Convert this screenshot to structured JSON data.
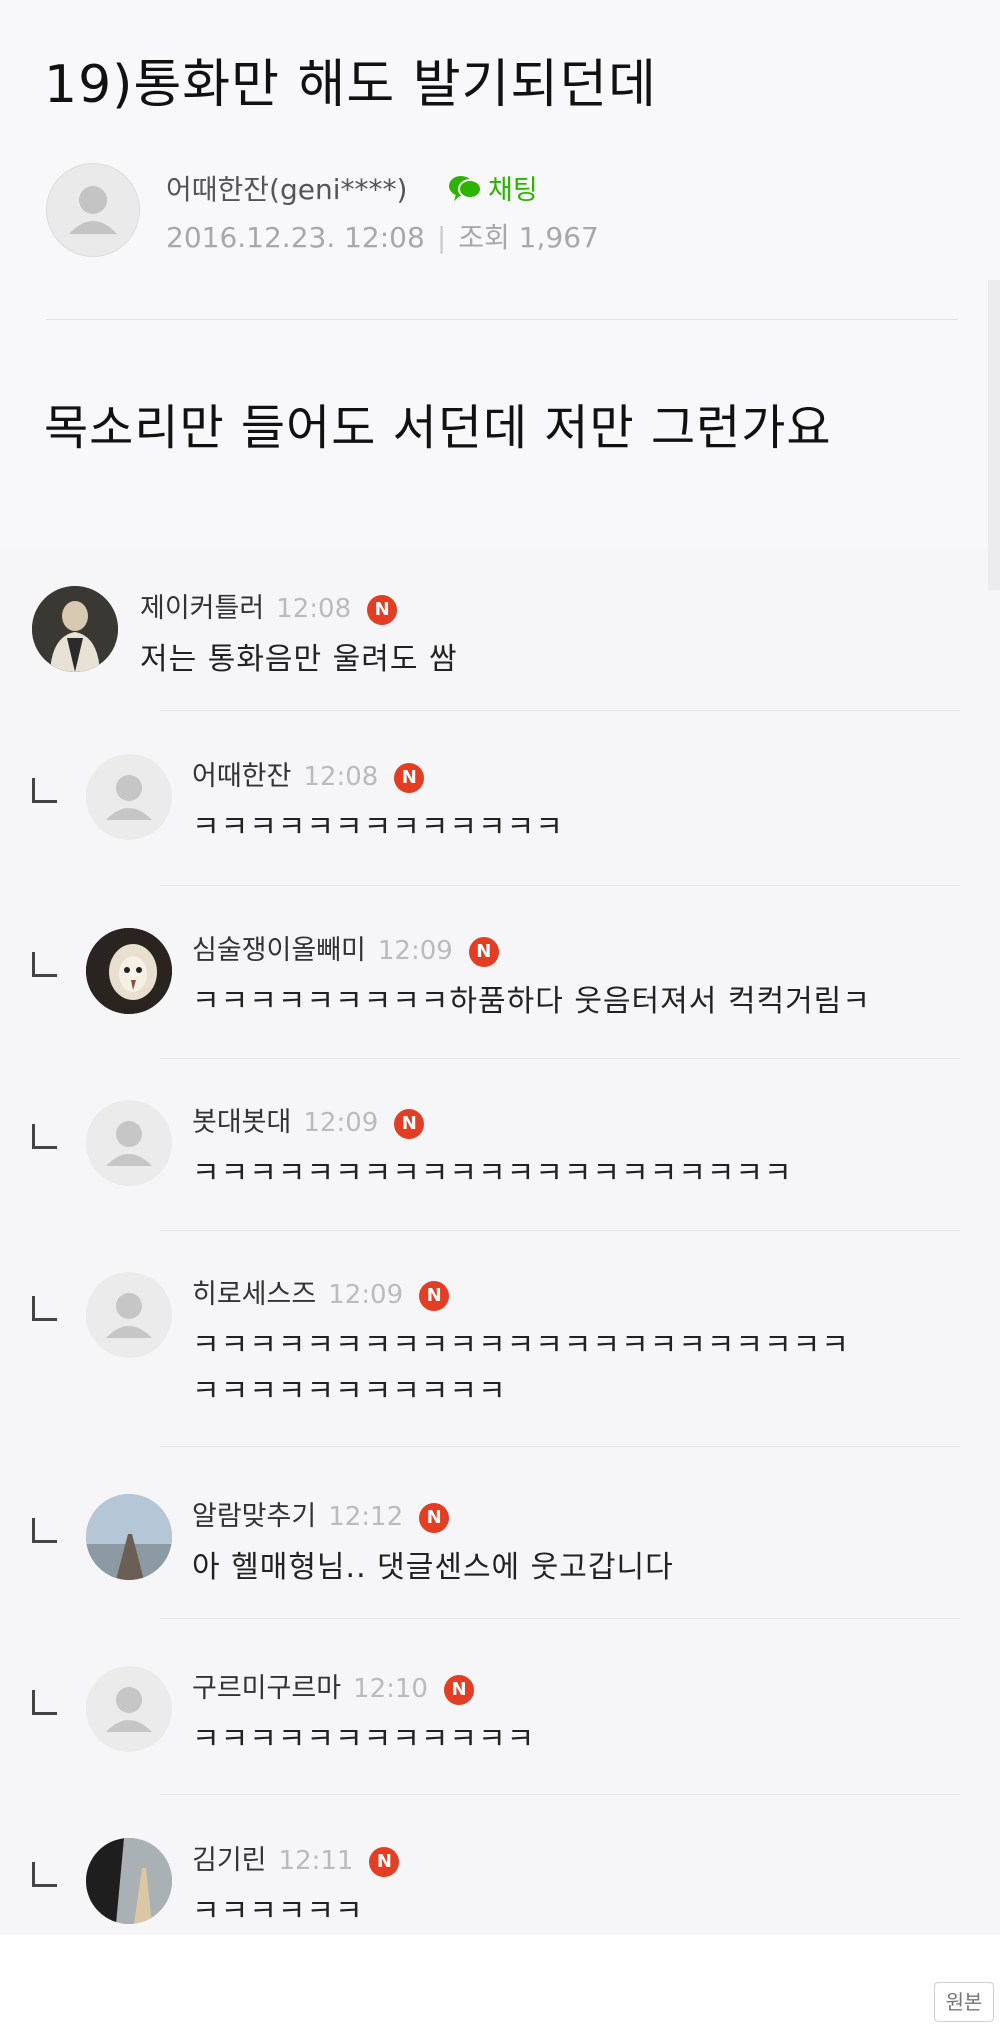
{
  "post": {
    "title": "19)통화만 해도 발기되던데",
    "author": "어때한잔(geni****)",
    "chat_label": "채팅",
    "date": "2016.12.23. 12:08",
    "views": "조회 1,967",
    "body": "목소리만 들어도 서던데 저만 그런가요"
  },
  "comments": [
    {
      "name": "제이커틀러",
      "time": "12:08",
      "badge": "N",
      "lines": [
        "저는 통화음만 울려도 쌈"
      ],
      "reply": false
    },
    {
      "name": "어때한잔",
      "time": "12:08",
      "badge": "N",
      "lines": [
        "ㅋㅋㅋㅋㅋㅋㅋㅋㅋㅋㅋㅋㅋ"
      ],
      "reply": true
    },
    {
      "name": "심술쟁이올빼미",
      "time": "12:09",
      "badge": "N",
      "lines": [
        "ㅋㅋㅋㅋㅋㅋㅋㅋㅋ하품하다 웃음터져서 컥컥거림ㅋ"
      ],
      "reply": true
    },
    {
      "name": "봇대봇대",
      "time": "12:09",
      "badge": "N",
      "lines": [
        "ㅋㅋㅋㅋㅋㅋㅋㅋㅋㅋㅋㅋㅋㅋㅋㅋㅋㅋㅋㅋㅋ"
      ],
      "reply": true
    },
    {
      "name": "히로세스즈",
      "time": "12:09",
      "badge": "N",
      "lines": [
        "ㅋㅋㅋㅋㅋㅋㅋㅋㅋㅋㅋㅋㅋㅋㅋㅋㅋㅋㅋㅋㅋㅋㅋ",
        "ㅋㅋㅋㅋㅋㅋㅋㅋㅋㅋㅋ"
      ],
      "reply": true
    },
    {
      "name": "알람맞추기",
      "time": "12:12",
      "badge": "N",
      "lines": [
        "아 헬매형님.. 댓글센스에 웃고갑니다"
      ],
      "reply": true
    },
    {
      "name": "구르미구르마",
      "time": "12:10",
      "badge": "N",
      "lines": [
        "ㅋㅋㅋㅋㅋㅋㅋㅋㅋㅋㅋㅋ"
      ],
      "reply": true
    },
    {
      "name": "김기린",
      "time": "12:11",
      "badge": "N",
      "lines": [
        "ㅋㅋㅋㅋㅋㅋ"
      ],
      "reply": true
    }
  ],
  "footer": {
    "original_button": "원본"
  }
}
